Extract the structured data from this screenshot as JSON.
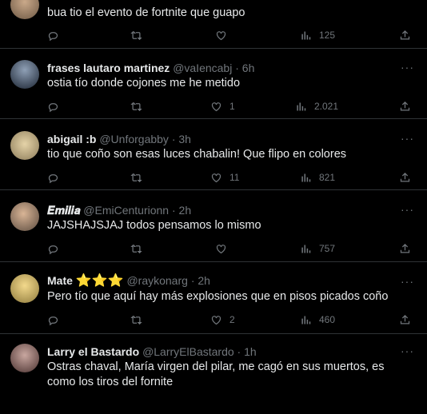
{
  "tweets": [
    {
      "name": "",
      "handle": "",
      "time": "",
      "text": "bua tio el evento de fortnite que guapo",
      "replies": "",
      "retweets": "",
      "likes": "",
      "views": "125"
    },
    {
      "name": "frases lautaro martinez",
      "handle": "@vaIencabj",
      "time": "6h",
      "text": "ostia tío donde cojones me he metido",
      "replies": "",
      "retweets": "",
      "likes": "1",
      "views": "2.021"
    },
    {
      "name": "abigail :b",
      "handle": "@Unforgabby",
      "time": "3h",
      "text": "tio que coño son esas luces chabalin! Que flipo en colores",
      "replies": "",
      "retweets": "",
      "likes": "11",
      "views": "821"
    },
    {
      "name": "𝑬𝒎𝒊𝒍𝒊𝒂",
      "handle": "@EmiCenturionn",
      "time": "2h",
      "text": "JAJSHAJSJAJ todos pensamos lo mismo",
      "replies": "",
      "retweets": "",
      "likes": "",
      "views": "757"
    },
    {
      "name": "Mate",
      "badges": "⭐⭐⭐",
      "handle": "@raykonarg",
      "time": "2h",
      "text": "Pero tío que aquí hay más explosiones que en pisos picados coño",
      "replies": "",
      "retweets": "",
      "likes": "2",
      "views": "460"
    },
    {
      "name": "Larry el Bastardo",
      "handle": "@LarryElBastardo",
      "time": "1h",
      "text": "Ostras chaval, María virgen del pilar, me cagó en sus muertos, es como los tiros del fornite",
      "replies": "",
      "retweets": "",
      "likes": "",
      "views": ""
    }
  ],
  "ui": {
    "more": "···",
    "dot": "·"
  },
  "colors": {
    "background": "#000000",
    "text": "#e7e9ea",
    "muted": "#71767b",
    "divider": "#2f3336"
  }
}
